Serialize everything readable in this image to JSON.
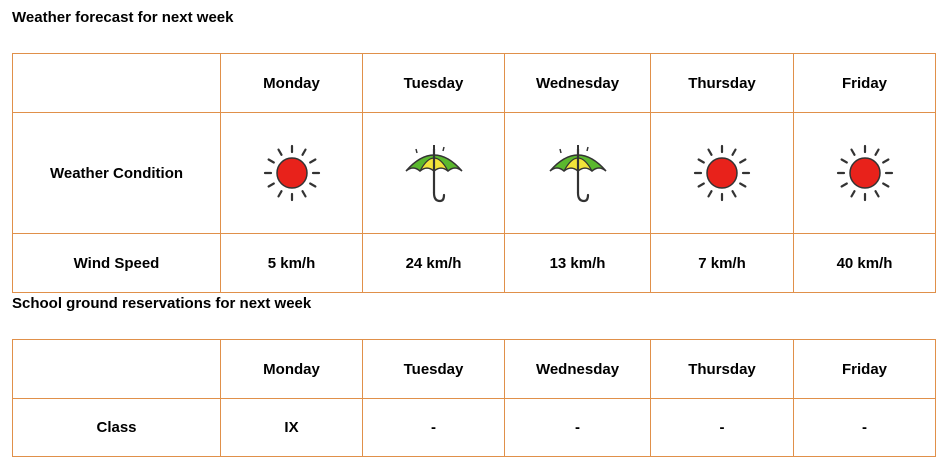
{
  "weather": {
    "heading": "Weather forecast for next week",
    "days": [
      "Monday",
      "Tuesday",
      "Wednesday",
      "Thursday",
      "Friday"
    ],
    "condition_label": "Weather Condition",
    "conditions": [
      "sun-icon",
      "umbrella-icon",
      "umbrella-icon",
      "sun-icon",
      "sun-icon"
    ],
    "wind_label": "Wind Speed",
    "wind_speeds": [
      "5 km/h",
      "24 km/h",
      "13 km/h",
      "7 km/h",
      "40 km/h"
    ]
  },
  "reservations": {
    "heading": "School ground reservations for next week",
    "days": [
      "Monday",
      "Tuesday",
      "Wednesday",
      "Thursday",
      "Friday"
    ],
    "class_label": "Class",
    "classes": [
      "IX",
      "-",
      "-",
      "-",
      "-"
    ]
  },
  "colors": {
    "border": "#e0904a",
    "sun": "#e8221b",
    "umbrella_green": "#5bb82e",
    "umbrella_yellow": "#f2e33a"
  }
}
